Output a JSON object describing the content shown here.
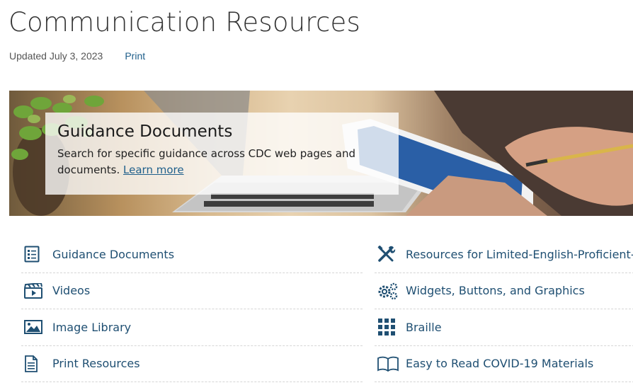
{
  "page": {
    "title": "Communication Resources",
    "updated": "Updated July 3, 2023",
    "print_label": "Print"
  },
  "hero": {
    "title": "Guidance Documents",
    "text": "Search for specific guidance across CDC web pages and documents.",
    "link": "Learn more"
  },
  "resources": {
    "left": [
      {
        "label": "Guidance Documents",
        "icon": "checklist-icon"
      },
      {
        "label": "Videos",
        "icon": "video-clapper-icon"
      },
      {
        "label": "Image Library",
        "icon": "image-icon"
      },
      {
        "label": "Print Resources",
        "icon": "document-icon"
      }
    ],
    "right": [
      {
        "label": "Resources for Limited-English-Proficient-",
        "icon": "tools-icon"
      },
      {
        "label": "Widgets, Buttons, and Graphics",
        "icon": "gears-icon"
      },
      {
        "label": "Braille",
        "icon": "grid-dots-icon"
      },
      {
        "label": "Easy to Read COVID-19 Materials",
        "icon": "open-book-icon"
      }
    ]
  },
  "colors": {
    "link": "#1f5f8b",
    "icon": "#1f4f72",
    "title": "#333333"
  }
}
